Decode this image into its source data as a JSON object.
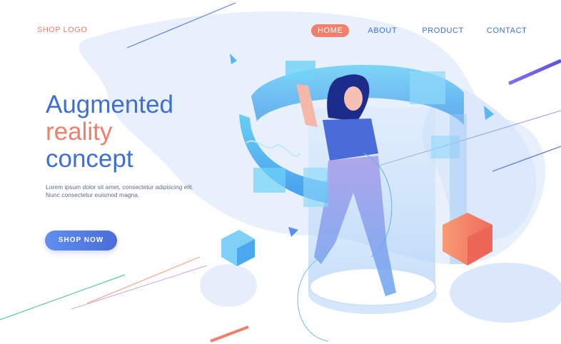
{
  "brand": {
    "logo_text": "SHOP LOGO",
    "logo_color": "#e8806a"
  },
  "nav": {
    "active_color": "#f07f6b",
    "items": [
      {
        "label": "HOME",
        "active": true
      },
      {
        "label": "ABOUT",
        "active": false
      },
      {
        "label": "PRODUCT",
        "active": false
      },
      {
        "label": "CONTACT",
        "active": false
      }
    ]
  },
  "hero": {
    "headline": [
      {
        "text": "Augmented",
        "color": "#3f6fd1"
      },
      {
        "text": "reality",
        "color": "#f07f6b"
      },
      {
        "text": "concept",
        "color": "#3f6fd1"
      }
    ],
    "description": [
      "Lorem ipsum dolor sit amet, consectetur adipiscing elit.",
      "Nunc consectetur euismod magna."
    ],
    "cta_label": "SHOP NOW"
  },
  "palette": {
    "blob": "#e4eefb",
    "cyan": "#5dc9f2",
    "deep_blue": "#3f6fd1",
    "coral": "#f07f6b",
    "purple": "#7b5be0"
  },
  "illustration": {
    "subject": "woman-in-ar-hologram-ring",
    "icons": [
      "hologram-ring-icon",
      "cube-icon",
      "triangle-icon"
    ]
  }
}
